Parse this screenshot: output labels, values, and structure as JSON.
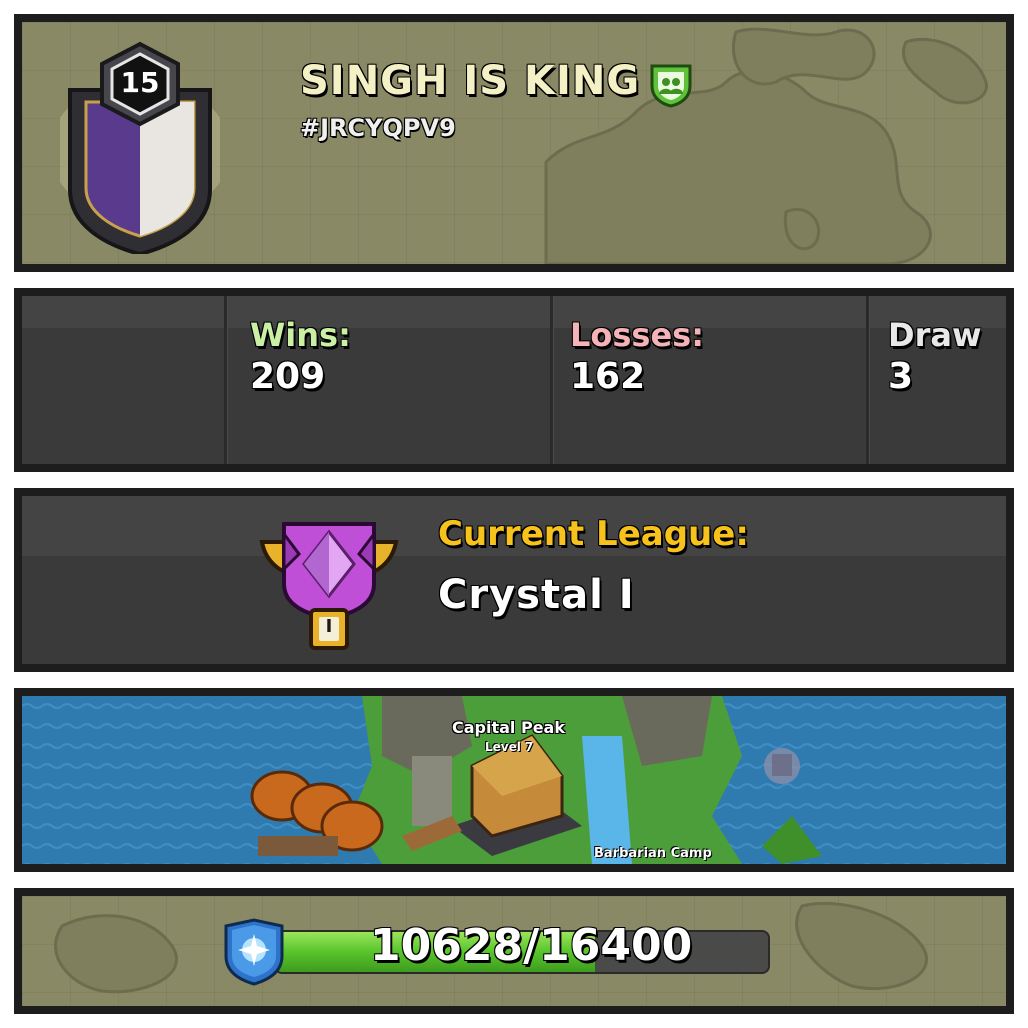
{
  "clan": {
    "name": "SINGH IS KING",
    "tag": "#JRCYQPV9",
    "level": "15"
  },
  "war_stats": {
    "wins_label": "Wins:",
    "wins_value": "209",
    "losses_label": "Losses:",
    "losses_value": "162",
    "draws_label": "Draw",
    "draws_value": "3"
  },
  "league": {
    "label": "Current League:",
    "value": "Crystal I",
    "badge_numeral": "I"
  },
  "capital": {
    "peak_name": "Capital Peak",
    "peak_level": "Level 7",
    "district_label": "Barbarian Camp"
  },
  "progress": {
    "text": "10628/16400",
    "current": 10628,
    "max": 16400
  },
  "colors": {
    "wins": "#c9f0a4",
    "losses": "#f5b3b8",
    "draws": "#e8e8e8",
    "league_label": "#f7c21b"
  }
}
